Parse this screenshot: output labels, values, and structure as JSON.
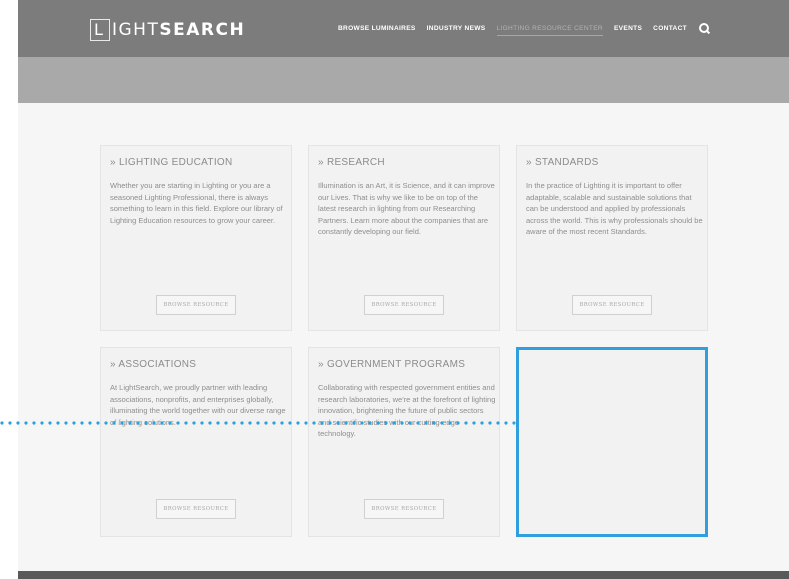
{
  "header": {
    "logo": {
      "letter": "L",
      "light": "IGHT",
      "bold": "SEARCH"
    },
    "menu": [
      {
        "label": "BROWSE LUMINAIRES",
        "active": false
      },
      {
        "label": "INDUSTRY NEWS",
        "active": false
      },
      {
        "label": "LIGHTING RESOURCE CENTER",
        "active": true
      },
      {
        "label": "EVENTS",
        "active": false
      },
      {
        "label": "CONTACT",
        "active": false
      }
    ],
    "search_icon": "search-icon"
  },
  "cards": [
    {
      "title": "» LIGHTING EDUCATION",
      "body": "Whether you are starting in Lighting or you are a seasoned Lighting Professional, there is always something to learn in this field. Explore our library of Lighting Education resources to grow your career.",
      "button": "BROWSE RESOURCE"
    },
    {
      "title": "» RESEARCH",
      "body": "Illumination is an Art, it is Science, and it can improve our Lives. That is why we like to be on top of the latest research in lighting from our Researching Partners. Learn more about the companies that are constantly developing our field.",
      "button": "BROWSE RESOURCE"
    },
    {
      "title": "» STANDARDS",
      "body": "In the practice of Lighting it is important to offer adaptable, scalable and sustainable solutions that can be understood and applied by professionals across the world. This is why professionals should be aware of the most recent Standards.",
      "button": "BROWSE RESOURCE"
    },
    {
      "title": "» ASSOCIATIONS",
      "body": "At LightSearch, we proudly partner with leading associations, nonprofits, and enterprises globally, illuminating the world together with our diverse range of lighting solutions.",
      "button": "BROWSE RESOURCE"
    },
    {
      "title": "» GOVERNMENT PROGRAMS",
      "body": "Collaborating with respected government entities and research laboratories, we're at the forefront of lighting innovation, brightening the future of public sectors and scientific studies with our cutting-edge technology.",
      "button": "BROWSE RESOURCE"
    }
  ],
  "colors": {
    "nav": "#7c7c7c",
    "banner": "#a9a9a9",
    "highlight": "#2f9fe0"
  }
}
